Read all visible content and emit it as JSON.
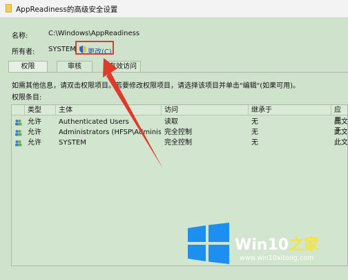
{
  "window": {
    "title": "AppReadiness的高级安全设置"
  },
  "owner_section": {
    "name_label": "名称:",
    "name_value": "C:\\Windows\\AppReadiness",
    "owner_label": "所有者:",
    "owner_value": "SYSTEM",
    "change_link": "更改(C)"
  },
  "tabs": [
    {
      "label": "权限",
      "active": true
    },
    {
      "label": "审核",
      "active": false
    },
    {
      "label": "有效访问",
      "active": false
    }
  ],
  "info_text": "如需其他信息，请双击权限项目。若要修改权限项目，请选择该项目并单击\"编辑\"(如果可用)。",
  "entries_label": "权限条目:",
  "table": {
    "headers": [
      "类型",
      "主体",
      "访问",
      "继承于",
      "应用于"
    ],
    "rows": [
      {
        "type": "允许",
        "principal": "Authenticated Users",
        "access": "读取",
        "inherited": "无",
        "applies": "此文件"
      },
      {
        "type": "允许",
        "principal": "Administrators (HFSP\\Administra...",
        "access": "完全控制",
        "inherited": "无",
        "applies": "此文件"
      },
      {
        "type": "允许",
        "principal": "SYSTEM",
        "access": "完全控制",
        "inherited": "无",
        "applies": "此文件"
      }
    ]
  },
  "watermark": {
    "brand_main": "Win10",
    "brand_accent": "之家",
    "url": "www.win10xitong.com"
  },
  "colors": {
    "highlight": "#e03a2c",
    "link": "#1a4fa0",
    "logo_blue": "#1d8ff0"
  }
}
